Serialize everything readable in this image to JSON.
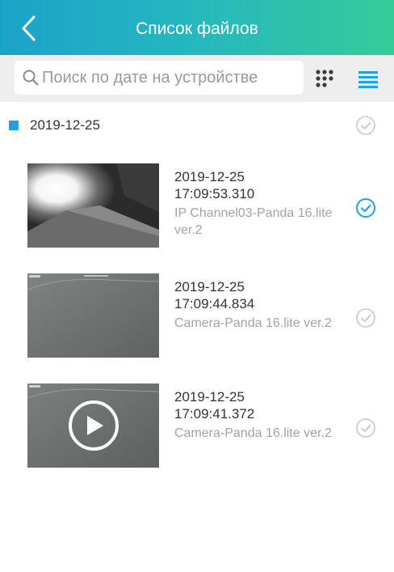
{
  "header": {
    "title": "Список файлов",
    "back_icon": "chevron-left-icon"
  },
  "toolbar": {
    "search_placeholder": "Поиск по дате на устройстве",
    "search_icon": "search-icon",
    "grid_view_icon": "grid-dots-icon",
    "list_view_icon": "list-icon",
    "list_view_active": true
  },
  "group": {
    "date": "2019-12-25",
    "selected": false
  },
  "files": [
    {
      "date": "2019-12-25",
      "time": "17:09:53.310",
      "name": "IP Channel03-Panda 16.lite ver.2",
      "type": "image",
      "selected": true
    },
    {
      "date": "2019-12-25",
      "time": "17:09:44.834",
      "name": "Camera-Panda 16.lite ver.2",
      "type": "image",
      "selected": false
    },
    {
      "date": "2019-12-25",
      "time": "17:09:41.372",
      "name": "Camera-Panda 16.lite ver.2",
      "type": "video",
      "selected": false
    }
  ],
  "colors": {
    "header_gradient_start": "#1aa3c8",
    "header_gradient_end": "#35cc9a",
    "accent": "#1ea2e6",
    "check_inactive": "#c8c8c8"
  }
}
